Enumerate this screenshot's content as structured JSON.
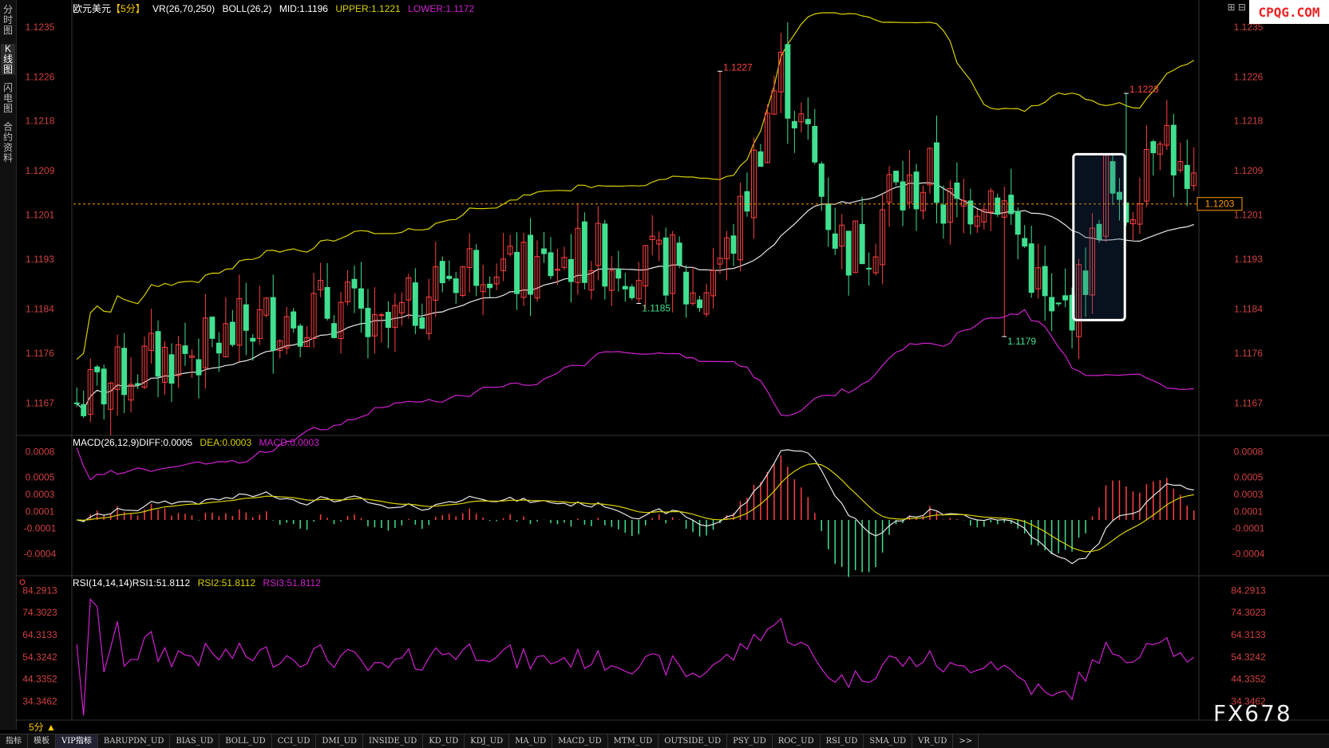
{
  "app": {
    "symbol": "欧元美元",
    "period_tag": "【5分】",
    "vr_label": "VR(26,70,250)",
    "boll_label": "BOLL(26,2)",
    "boll_mid": "MID:1.1196",
    "boll_upper": "UPPER:1.1221",
    "boll_lower": "LOWER:1.1172",
    "macd_label": "MACD(26,12,9)",
    "macd_diff": "DIFF:0.0005",
    "macd_dea": "DEA:0.0003",
    "macd_macd": "MACD:0.0003",
    "rsi_label": "RSI(14,14,14)",
    "rsi1": "RSI1:51.8112",
    "rsi2": "RSI2:51.8112",
    "rsi3": "RSI3:51.8112",
    "current_price": "1.1203",
    "period_button": "5分 ▲",
    "watermark": "FX678",
    "logo": "CPQG.COM",
    "colors": {
      "up": "#ff4040",
      "down": "#40e090",
      "upper": "#d8d000",
      "mid": "#e8e8e8",
      "lower": "#d020d0",
      "rsi": "#d020d0",
      "price_line": "#ff9900"
    }
  },
  "side_tabs": [
    "分时图",
    "K线图",
    "闪电图",
    "合约资料"
  ],
  "bottom_tabs": [
    "指标",
    "模板",
    "VIP指标",
    "BARUPDN_UD",
    "BIAS_UD",
    "BOLL_UD",
    "CCI_UD",
    "DMI_UD",
    "INSIDE_UD",
    "KD_UD",
    "KDJ_UD",
    "MA_UD",
    "MACD_UD",
    "MTM_UD",
    "OUTSIDE_UD",
    "PSY_UD",
    "ROC_UD",
    "RSI_UD",
    "SMA_UD",
    "VR_UD",
    ">>"
  ],
  "chart_data": [
    {
      "type": "candlestick",
      "title": "欧元美元 5分",
      "price_ticks": [
        "1.1235",
        "1.1226",
        "1.1218",
        "1.1209",
        "1.1201",
        "1.1193",
        "1.1184",
        "1.1176",
        "1.1167"
      ],
      "ylim": [
        1.1162,
        1.1237
      ],
      "annotations": [
        {
          "text": "1.1227",
          "price": 1.1227,
          "bar": 95,
          "kind": "high"
        },
        {
          "text": "1.1185",
          "price": 1.1185,
          "bar": 83,
          "kind": "low"
        },
        {
          "text": "1.1179",
          "price": 1.1179,
          "bar": 137,
          "kind": "low"
        },
        {
          "text": "1.1223",
          "price": 1.1223,
          "bar": 155,
          "kind": "high"
        }
      ],
      "current_price": 1.1203,
      "highlight": {
        "from_bar": 148,
        "to_bar": 154
      },
      "close_anchors": [
        [
          0,
          1.1167
        ],
        [
          4,
          1.117
        ],
        [
          8,
          1.1173
        ],
        [
          12,
          1.1175
        ],
        [
          16,
          1.1176
        ],
        [
          20,
          1.1177
        ],
        [
          24,
          1.118
        ],
        [
          28,
          1.1182
        ],
        [
          32,
          1.1183
        ],
        [
          36,
          1.1184
        ],
        [
          40,
          1.1184
        ],
        [
          42,
          1.1182
        ],
        [
          44,
          1.1178
        ],
        [
          46,
          1.118
        ],
        [
          50,
          1.1185
        ],
        [
          54,
          1.119
        ],
        [
          58,
          1.1192
        ],
        [
          60,
          1.1194
        ],
        [
          62,
          1.1193
        ],
        [
          64,
          1.119
        ],
        [
          68,
          1.1191
        ],
        [
          72,
          1.1193
        ],
        [
          76,
          1.1194
        ],
        [
          80,
          1.1193
        ],
        [
          84,
          1.1191
        ],
        [
          88,
          1.1192
        ],
        [
          90,
          1.1187
        ],
        [
          92,
          1.1186
        ],
        [
          94,
          1.1192
        ],
        [
          96,
          1.1194
        ],
        [
          98,
          1.12
        ],
        [
          100,
          1.121
        ],
        [
          102,
          1.122
        ],
        [
          104,
          1.1227
        ],
        [
          106,
          1.122
        ],
        [
          108,
          1.1214
        ],
        [
          110,
          1.1205
        ],
        [
          112,
          1.1198
        ],
        [
          114,
          1.1195
        ],
        [
          116,
          1.1196
        ],
        [
          118,
          1.1198
        ],
        [
          120,
          1.1206
        ],
        [
          122,
          1.1204
        ],
        [
          124,
          1.1206
        ],
        [
          126,
          1.1208
        ],
        [
          128,
          1.1203
        ],
        [
          130,
          1.1201
        ],
        [
          132,
          1.1204
        ],
        [
          134,
          1.1206
        ],
        [
          136,
          1.1205
        ],
        [
          138,
          1.12
        ],
        [
          140,
          1.1195
        ],
        [
          142,
          1.1188
        ],
        [
          144,
          1.1181
        ],
        [
          146,
          1.1184
        ],
        [
          148,
          1.1187
        ],
        [
          150,
          1.1195
        ],
        [
          152,
          1.1208
        ],
        [
          154,
          1.1199
        ],
        [
          156,
          1.1204
        ],
        [
          158,
          1.1214
        ],
        [
          160,
          1.1219
        ],
        [
          162,
          1.1212
        ],
        [
          164,
          1.1203
        ]
      ]
    },
    {
      "type": "macd",
      "ticks": [
        "0.0008",
        "0.0005",
        "0.0003",
        "0.0001",
        "-0.0001",
        "-0.0004"
      ],
      "ylim": [
        -0.0006,
        0.0009
      ]
    },
    {
      "type": "line",
      "name": "RSI",
      "ticks": [
        "84.2913",
        "74.3023",
        "64.3133",
        "54.3242",
        "44.3352",
        "34.3462"
      ],
      "ylim": [
        27,
        88
      ]
    }
  ]
}
